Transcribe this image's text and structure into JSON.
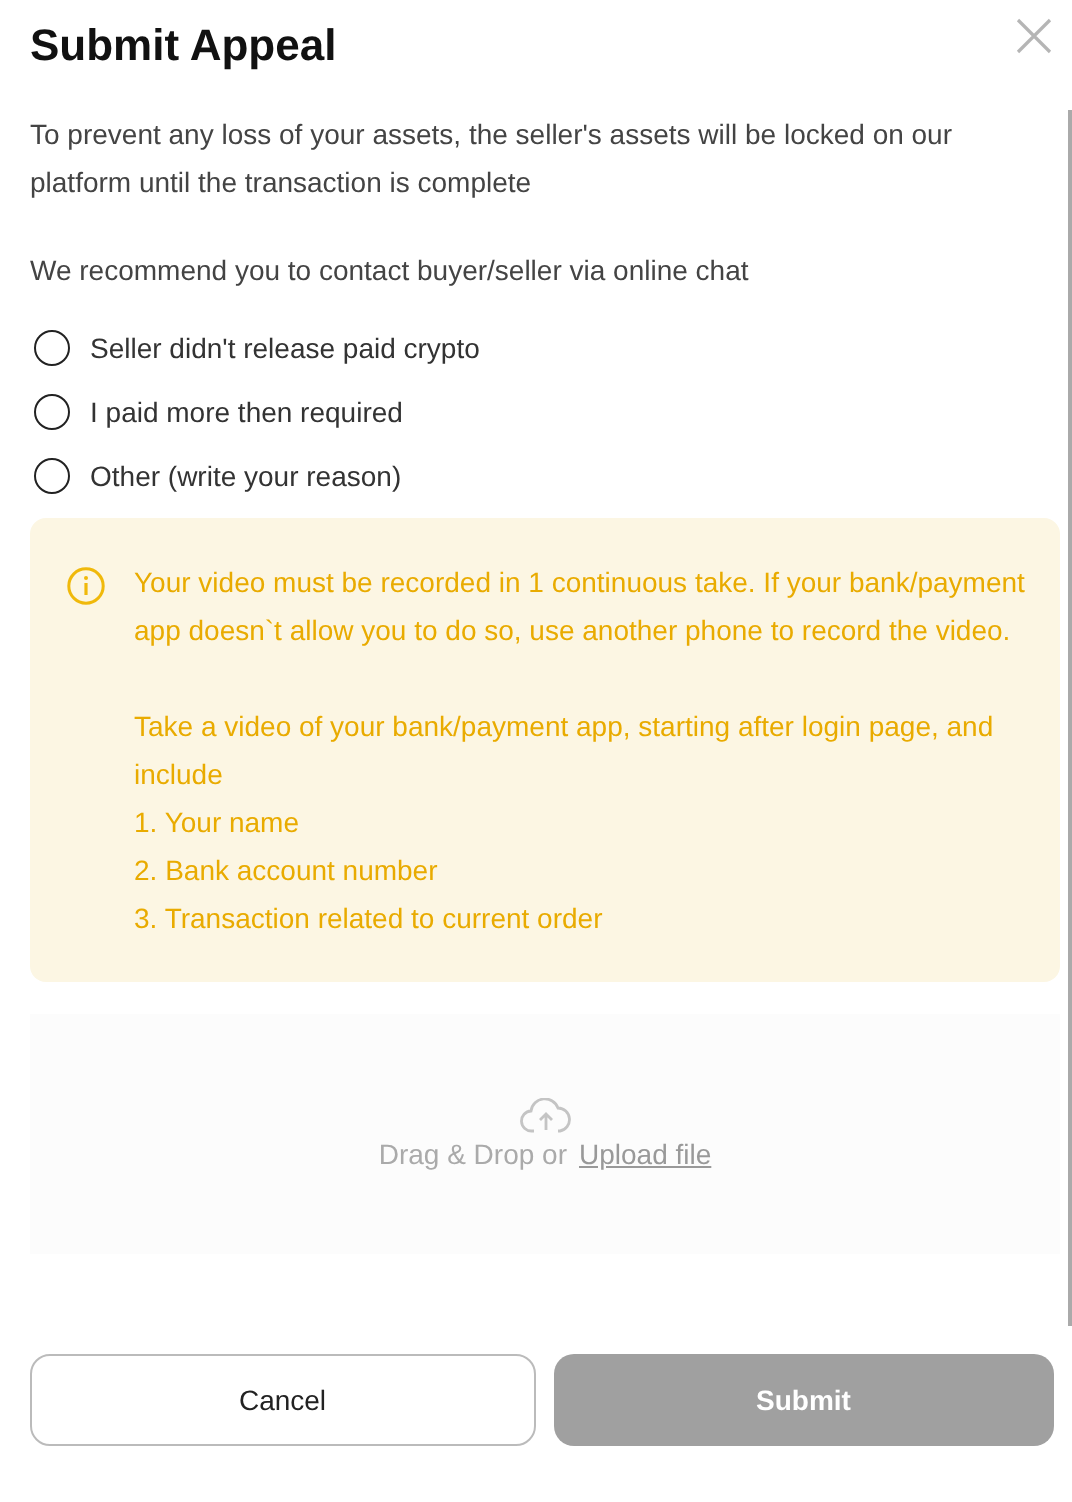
{
  "dialog": {
    "title": "Submit Appeal"
  },
  "intro": [
    "To prevent any loss of your assets, the seller's assets will be locked on our platform until the transaction is complete",
    "We recommend you to contact buyer/seller via online chat"
  ],
  "reasons": [
    {
      "label": "Seller didn't release paid crypto",
      "selected": false
    },
    {
      "label": "I paid more then required",
      "selected": false
    },
    {
      "label": "Other (write your reason)",
      "selected": false
    }
  ],
  "notice": {
    "paragraphs": [
      "Your video must be recorded in 1 continuous take. If your bank/payment app doesn`t allow you to do so, use another phone to record the video.",
      "Take a video of your bank/payment app, starting after login page, and include"
    ],
    "list": [
      "1. Your name",
      "2. Bank account number",
      "3. Transaction related to current order"
    ]
  },
  "upload": {
    "prompt": "Drag & Drop or",
    "link": "Upload file"
  },
  "buttons": [
    {
      "label": "Cancel",
      "kind": "secondary",
      "disabled": false
    },
    {
      "label": "Submit",
      "kind": "primary",
      "disabled": true
    }
  ]
}
